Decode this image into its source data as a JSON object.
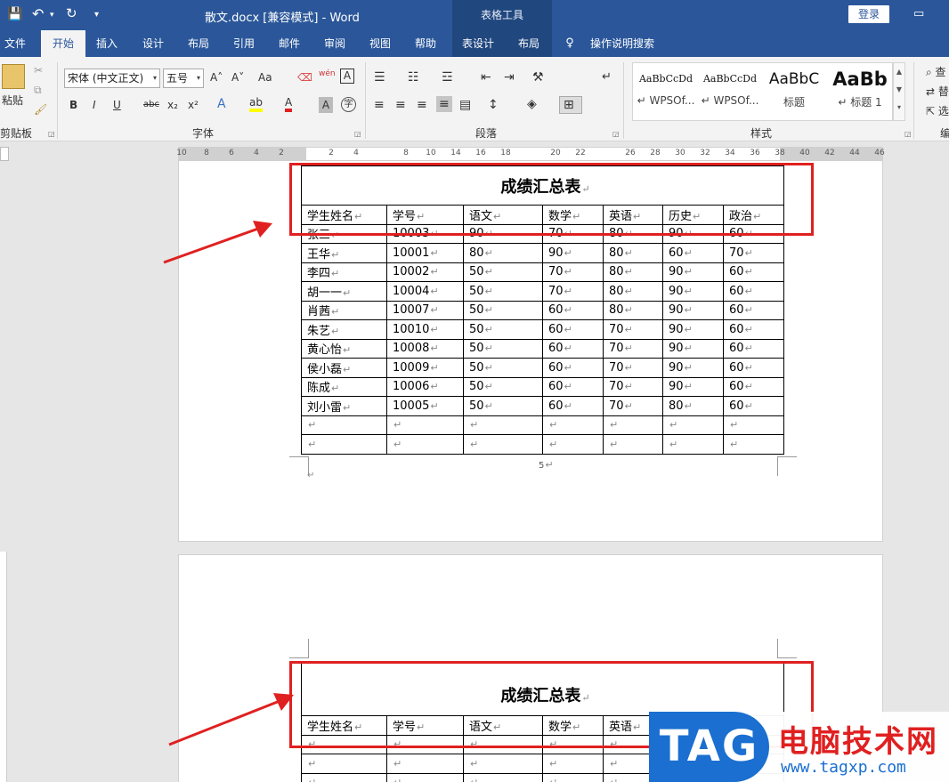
{
  "titlebar": {
    "save_icon": "💾",
    "undo_icon": "↶",
    "redo_icon": "↻",
    "customize_icon": "▾",
    "doc_title": "散文.docx [兼容模式]  -  Word",
    "context_tab": "表格工具",
    "login": "登录",
    "restore_icon": "▭"
  },
  "tabs": [
    "文件",
    "开始",
    "插入",
    "设计",
    "布局",
    "引用",
    "邮件",
    "审阅",
    "视图",
    "帮助",
    "表设计",
    "布局"
  ],
  "tell_me": "操作说明搜索",
  "ribbon": {
    "paste_label": "粘贴",
    "clipboard_label": "剪贴板",
    "font_name": "宋体 (中文正文)",
    "font_size": "五号",
    "font_label": "字体",
    "paragraph_label": "段落",
    "styles_label": "样式",
    "edit_label": "编",
    "font_buttons": {
      "grow": "A˄",
      "shrink": "A˅",
      "case": "Aa",
      "phonetic": "wén",
      "border_a": "A",
      "bold": "B",
      "italic": "I",
      "underline": "U",
      "strike": "abc",
      "sub": "x₂",
      "sup": "x²",
      "effect": "A",
      "font_color": "A",
      "shade": "A",
      "circle": "字"
    },
    "styles": [
      {
        "preview": "AaBbCcDd",
        "name": "↵ WPSOf..."
      },
      {
        "preview": "AaBbCcDd",
        "name": "↵ WPSOf..."
      },
      {
        "preview": "AaBbC",
        "name": "标题"
      },
      {
        "preview": "AaBb",
        "name": "↵ 标题 1"
      }
    ],
    "edit_items": [
      "查",
      "替",
      "选"
    ]
  },
  "ruler_numbers": [
    "10",
    "8",
    "6",
    "4",
    "2",
    "2",
    "4",
    "8",
    "10",
    "14",
    "16",
    "18",
    "20",
    "22",
    "26",
    "28",
    "30",
    "32",
    "34",
    "36",
    "38",
    "40",
    "42",
    "44",
    "46"
  ],
  "table": {
    "title": "成绩汇总表",
    "return_mark": "↵",
    "headers": [
      "学生姓名",
      "学号",
      "语文",
      "数学",
      "英语",
      "历史",
      "政治"
    ],
    "rows": [
      [
        "张三",
        "10003",
        "90",
        "70",
        "80",
        "90",
        "60"
      ],
      [
        "王华",
        "10001",
        "80",
        "90",
        "80",
        "60",
        "70"
      ],
      [
        "李四",
        "10002",
        "50",
        "70",
        "80",
        "90",
        "60"
      ],
      [
        "胡一一",
        "10004",
        "50",
        "70",
        "80",
        "90",
        "60"
      ],
      [
        "肖茜",
        "10007",
        "50",
        "60",
        "80",
        "90",
        "60"
      ],
      [
        "朱艺",
        "10010",
        "50",
        "60",
        "70",
        "90",
        "60"
      ],
      [
        "黄心怡",
        "10008",
        "50",
        "60",
        "70",
        "90",
        "60"
      ],
      [
        "侯小磊",
        "10009",
        "50",
        "60",
        "70",
        "90",
        "60"
      ],
      [
        "陈成",
        "10006",
        "50",
        "60",
        "70",
        "90",
        "60"
      ],
      [
        "刘小雷",
        "10005",
        "50",
        "60",
        "70",
        "80",
        "60"
      ]
    ]
  },
  "page_number": "5",
  "watermark": {
    "tag": "TAG",
    "cn": "电脑技术网",
    "url": "www.tagxp.com"
  },
  "colors": {
    "word_blue": "#2b579a",
    "highlight_red": "#e02020",
    "tag_blue": "#1a6fd0"
  }
}
